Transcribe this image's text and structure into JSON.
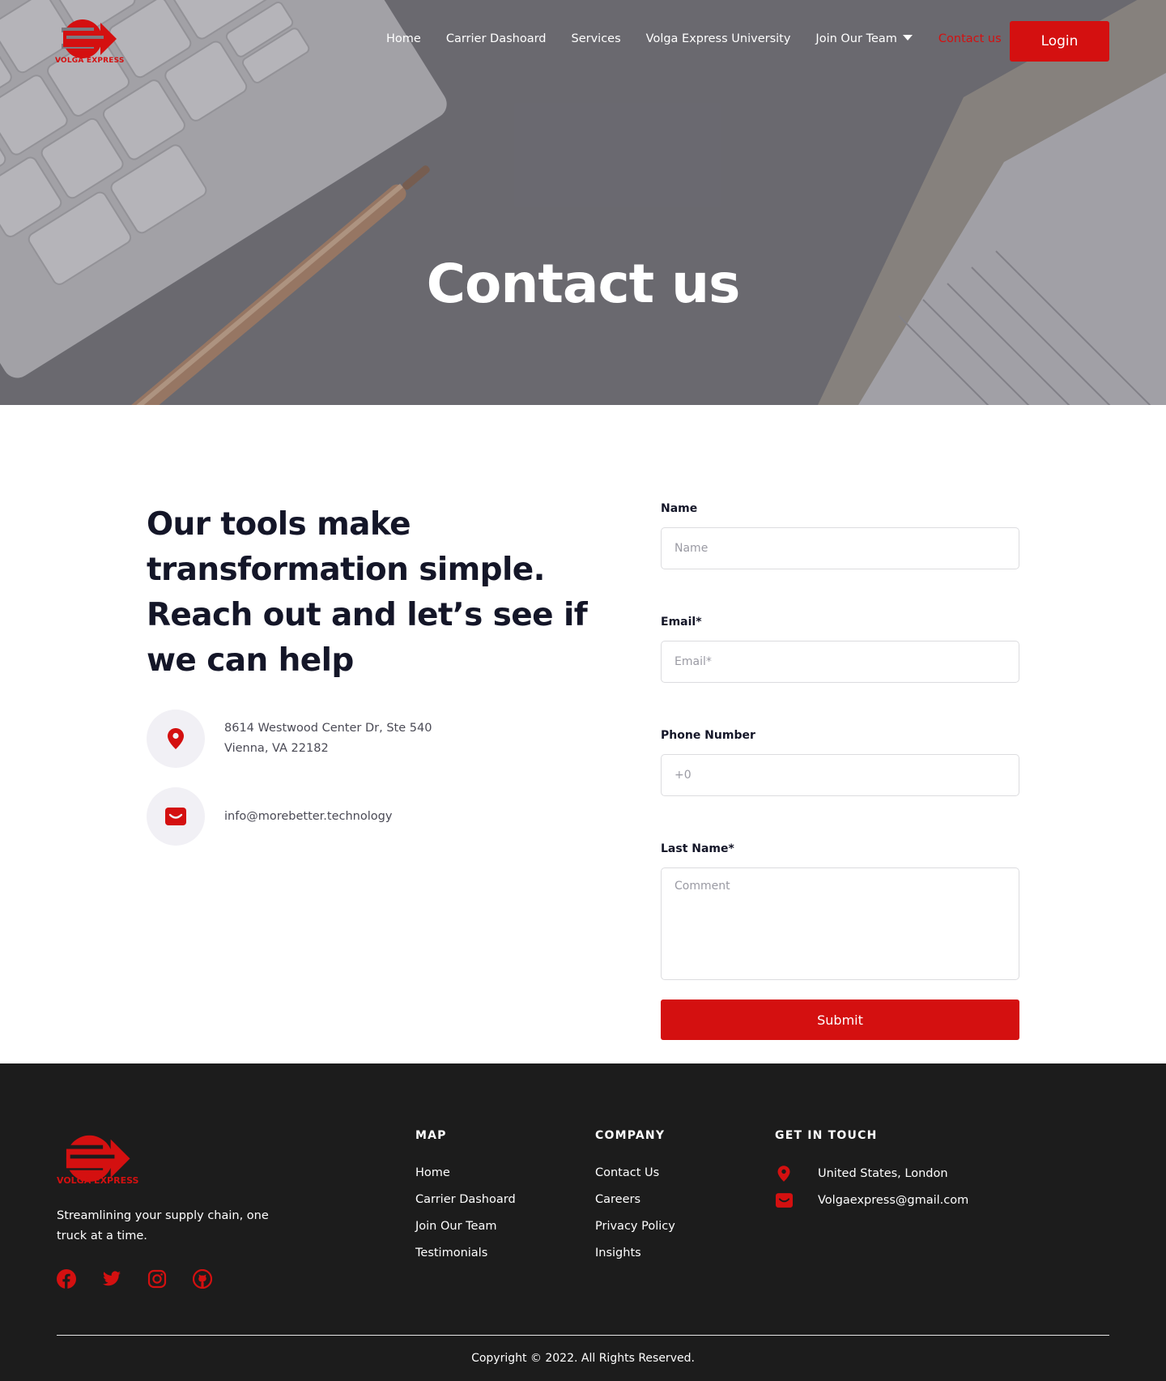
{
  "brand": {
    "name": "VOLGA EXPRESS",
    "accent_color": "#d41010",
    "dark_text": "#141628"
  },
  "nav": {
    "items": [
      {
        "label": "Home"
      },
      {
        "label": "Carrier Dashoard"
      },
      {
        "label": "Services"
      },
      {
        "label": "Volga Express University"
      },
      {
        "label": "Join Our Team",
        "has_dropdown": true
      },
      {
        "label": "Contact us",
        "active": true
      }
    ],
    "login_label": "Login"
  },
  "hero": {
    "title": "Contact us"
  },
  "intro": {
    "headline": "Our tools make transformation simple. Reach out and let’s see if we can help",
    "address_line1": "8614 Westwood Center Dr, Ste 540",
    "address_line2": "Vienna, VA 22182",
    "email": "info@morebetter.technology"
  },
  "form": {
    "name_label": "Name",
    "name_placeholder": "Name",
    "email_label": "Email*",
    "email_placeholder": "Email*",
    "phone_label": "Phone Number",
    "phone_placeholder": "+0",
    "comment_label": "Last Name*",
    "comment_placeholder": "Comment",
    "submit_label": "Submit"
  },
  "footer": {
    "brand_name": "VOLGA EXPRESS",
    "tagline": "Streamlining your supply chain, one truck at a time.",
    "socials": [
      "facebook-icon",
      "twitter-icon",
      "instagram-icon",
      "github-icon"
    ],
    "map": {
      "title": "MAP",
      "items": [
        "Home",
        "Carrier Dashoard",
        "Join Our Team",
        "Testimonials"
      ]
    },
    "company": {
      "title": "COMPANY",
      "items": [
        "Contact Us",
        "Careers",
        "Privacy Policy",
        "Insights"
      ]
    },
    "touch": {
      "title": "GET IN TOUCH",
      "location": "United States, London",
      "email": "Volgaexpress@gmail.com"
    },
    "copyright": "Copyright © 2022. All Rights Reserved."
  }
}
